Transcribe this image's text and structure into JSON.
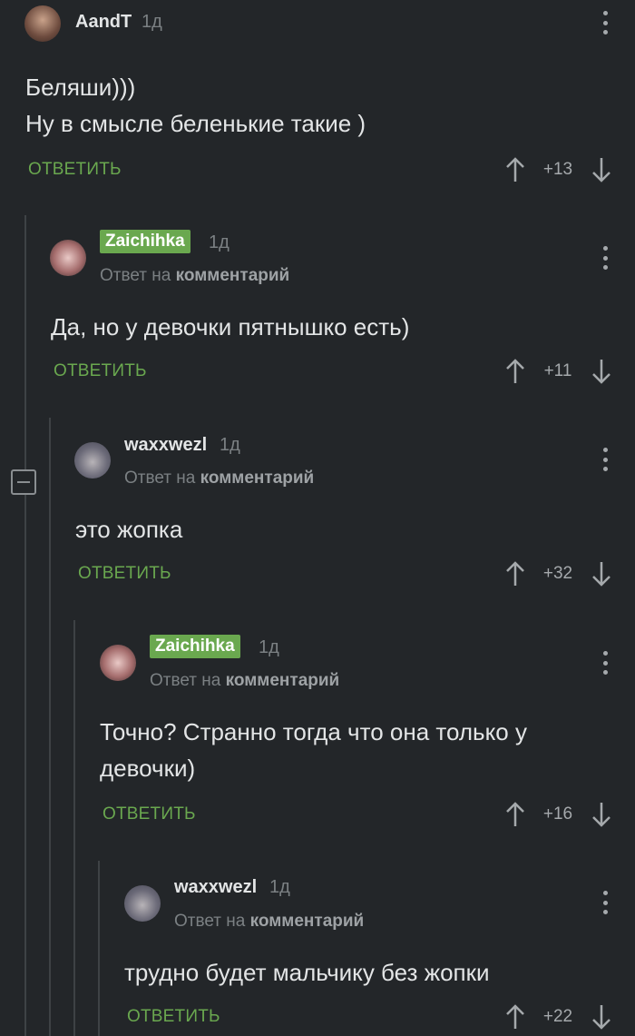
{
  "comments": [
    {
      "username": "AandT",
      "time": "1д",
      "reply_prefix": "",
      "reply_target": "",
      "text_lines": [
        "Беляши)))",
        "Ну в смысле беленькие такие )"
      ],
      "reply_label": "ОТВЕТИТЬ",
      "rating": "+13"
    },
    {
      "username": "Zaichihka",
      "time": "1д",
      "reply_prefix": "Ответ на",
      "reply_target": "комментарий",
      "text_lines": [
        "Да, но у девочки пятнышко есть)"
      ],
      "reply_label": "ОТВЕТИТЬ",
      "rating": "+11"
    },
    {
      "username": "waxxwezl",
      "time": "1д",
      "reply_prefix": "Ответ на",
      "reply_target": "комментарий",
      "text_lines": [
        "это жопка"
      ],
      "reply_label": "ОТВЕТИТЬ",
      "rating": "+32"
    },
    {
      "username": "Zaichihka",
      "time": "1д",
      "reply_prefix": "Ответ на",
      "reply_target": "комментарий",
      "text_lines": [
        "Точно? Странно тогда что она только у",
        "девочки)"
      ],
      "reply_label": "ОТВЕТИТЬ",
      "rating": "+16"
    },
    {
      "username": "waxxwezl",
      "time": "1д",
      "reply_prefix": "Ответ на",
      "reply_target": "комментарий",
      "text_lines": [
        "трудно будет мальчику без жопки"
      ],
      "reply_label": "ОТВЕТИТЬ",
      "rating": "+22"
    }
  ],
  "colors": {
    "background": "#232629",
    "accent_green": "#6aa84f",
    "muted_text": "#7b8083",
    "primary_text": "#e3e5e6"
  }
}
